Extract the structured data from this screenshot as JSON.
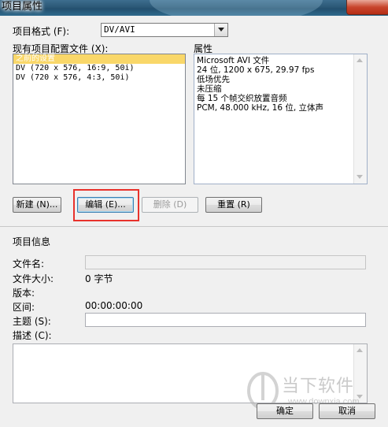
{
  "window": {
    "title": "项目属性"
  },
  "format": {
    "label": "项目格式 (F):",
    "value": "DV/AVI"
  },
  "presets": {
    "label": "现有项目配置文件 (X):",
    "items": [
      "之前的设置",
      "DV (720 x 576, 16:9, 50i)",
      "DV (720 x 576, 4:3, 50i)"
    ],
    "selected_index": 0
  },
  "properties": {
    "label": "属性",
    "lines": [
      "Microsoft AVI 文件",
      "24 位, 1200 x 675, 29.97 fps",
      "低场优先",
      "未压缩",
      "每 15 个帧交织放置音频",
      "PCM, 48.000 kHz, 16 位, 立体声"
    ]
  },
  "buttons": {
    "new": "新建 (N)...",
    "edit": "编辑 (E)...",
    "delete": "删除 (D)",
    "reset": "重置 (R)",
    "ok": "确定",
    "cancel": "取消"
  },
  "info": {
    "heading": "项目信息",
    "filename_label": "文件名:",
    "filename_value": "",
    "filesize_label": "文件大小:",
    "filesize_value": "0 字节",
    "version_label": "版本:",
    "duration_label": "区间:",
    "duration_value": "00:00:00:00",
    "subject_label": "主题 (S):",
    "subject_value": "",
    "description_label": "描述 (C):",
    "description_value": ""
  },
  "watermark": {
    "name": "当下软件园",
    "url": "www.downxia.com"
  },
  "colors": {
    "selection": "#f9d769",
    "highlight_box": "#e8322c",
    "dialog_bg": "#f0f0f0"
  }
}
